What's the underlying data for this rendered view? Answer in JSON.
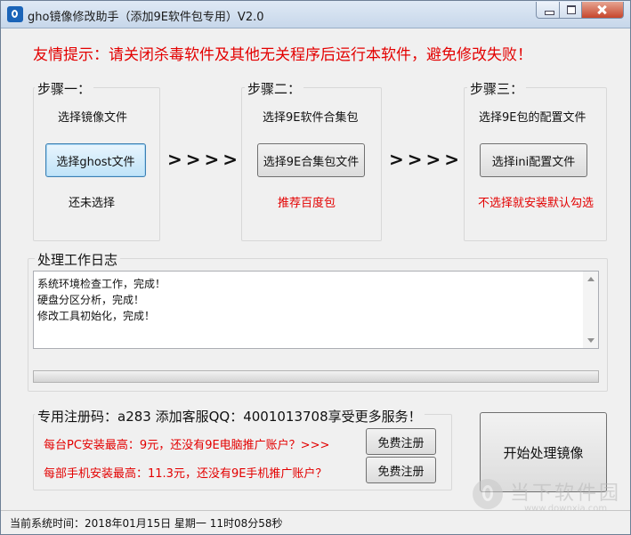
{
  "window": {
    "title": "gho镜像修改助手（添加9E软件包专用）V2.0",
    "icon": "app-logo-icon"
  },
  "warning": "友情提示：请关闭杀毒软件及其他无关程序后运行本软件，避免修改失败！",
  "steps": [
    {
      "title": "步骤一：",
      "description": "选择镜像文件",
      "button": "选择ghost文件",
      "status": "还未选择"
    },
    {
      "title": "步骤二：",
      "description": "选择9E软件合集包",
      "button": "选择9E合集包文件",
      "status": "推荐百度包"
    },
    {
      "title": "步骤三：",
      "description": "选择9E包的配置文件",
      "button": "选择ini配置文件",
      "status": "不选择就安装默认勾选"
    }
  ],
  "arrows": ">>>>",
  "log": {
    "title": "处理工作日志",
    "lines": [
      "系统环境检查工作，完成！",
      "硬盘分区分析，完成！",
      "修改工具初始化，完成！"
    ]
  },
  "progress": {
    "value": 0
  },
  "register": {
    "title": "专用注册码：a283  添加客服QQ：4001013708享受更多服务！",
    "pc_text": "每台PC安装最高：9元，还没有9E电脑推广账户？>>>",
    "pc_button": "免费注册",
    "mobile_text": "每部手机安装最高：11.3元，还没有9E手机推广账户？",
    "mobile_button": "免费注册"
  },
  "start_button": "开始处理镜像",
  "status_bar": "当前系统时间：2018年01月15日 星期一 11时08分58秒",
  "watermark": {
    "name": "当下软件园",
    "url": "www.downxia.com"
  },
  "colors": {
    "warning": "#e30000",
    "title_bar": "#c7d7ea",
    "progress": "#3fb43f"
  }
}
